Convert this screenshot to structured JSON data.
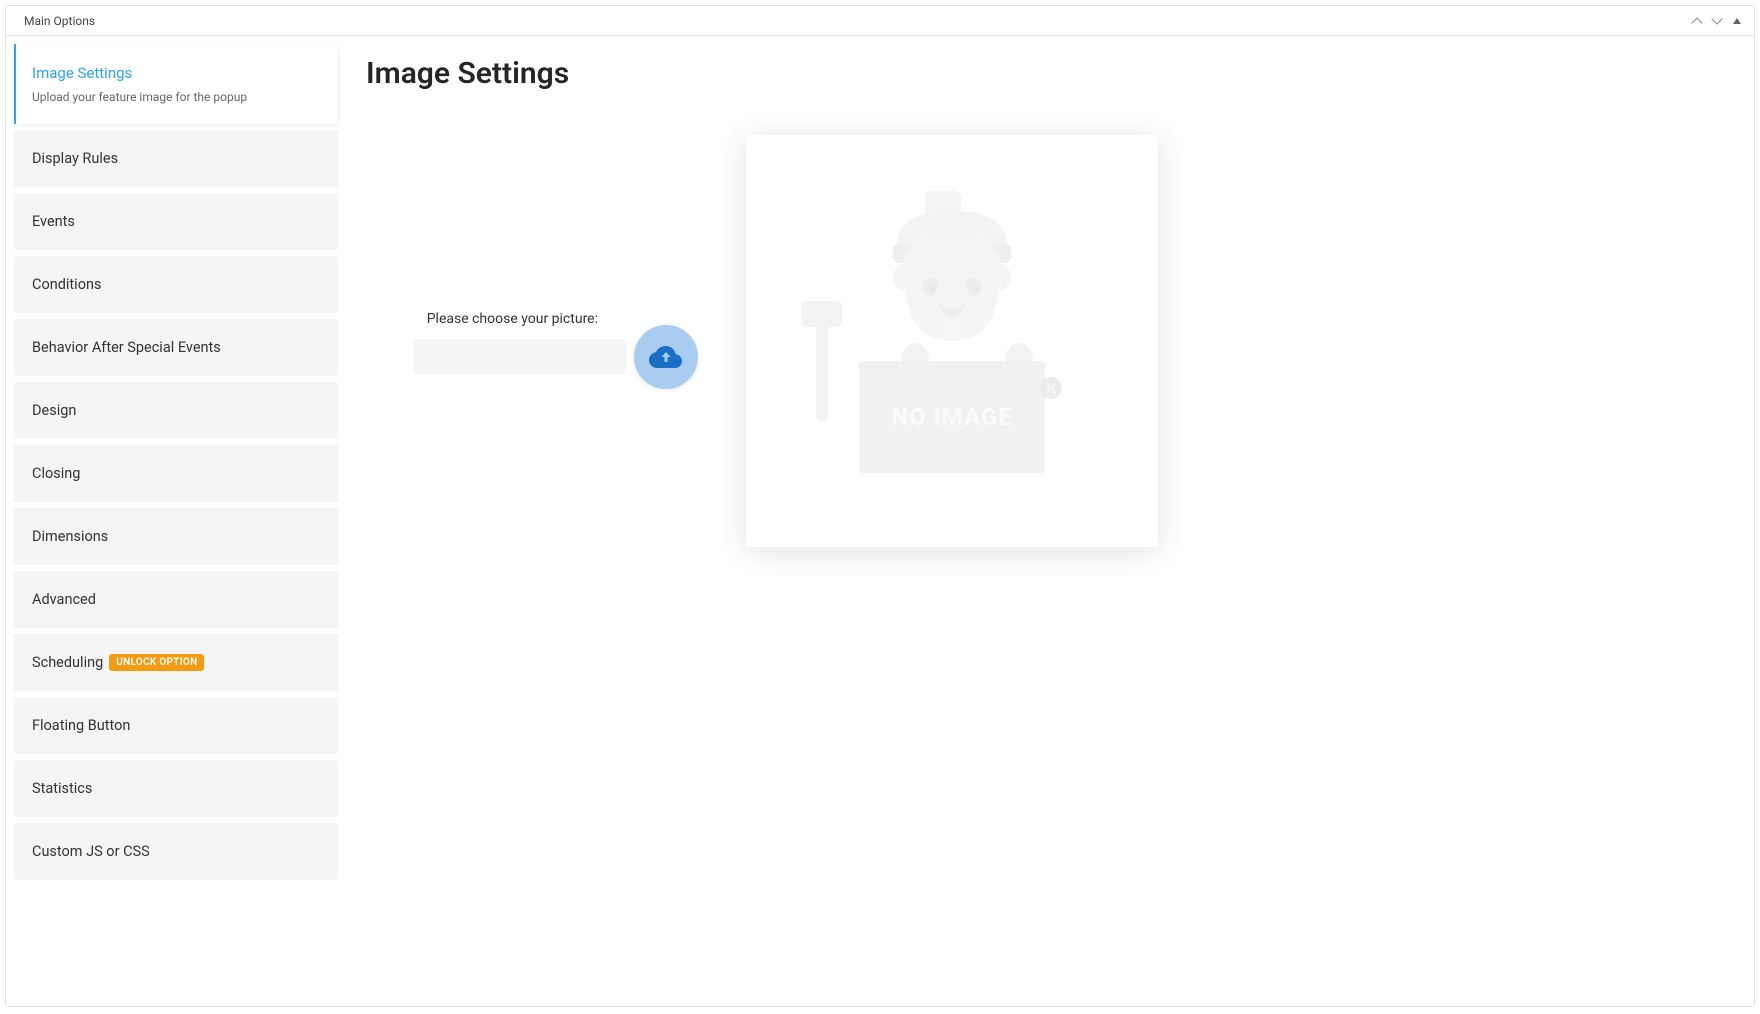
{
  "panel": {
    "title": "Main Options"
  },
  "sidebar": {
    "items": [
      {
        "label": "Image Settings",
        "subtitle": "Upload your feature image for the popup",
        "active": true
      },
      {
        "label": "Display Rules"
      },
      {
        "label": "Events"
      },
      {
        "label": "Conditions"
      },
      {
        "label": "Behavior After Special Events"
      },
      {
        "label": "Design"
      },
      {
        "label": "Closing"
      },
      {
        "label": "Dimensions"
      },
      {
        "label": "Advanced"
      },
      {
        "label": "Scheduling",
        "badge": "UNLOCK OPTION"
      },
      {
        "label": "Floating Button"
      },
      {
        "label": "Statistics"
      },
      {
        "label": "Custom JS or CSS"
      }
    ]
  },
  "content": {
    "heading": "Image Settings",
    "upload_label": "Please choose your picture:",
    "upload_value": "",
    "preview_placeholder_text": "NO IMAGE"
  },
  "colors": {
    "accent": "#2ea3f2",
    "badge_bg": "#f39c12",
    "upload_btn_bg": "#a8cdf0",
    "upload_btn_icon": "#1a6fc4"
  },
  "icons": {
    "chevron_up": "chevron-up-icon",
    "chevron_down": "chevron-down-icon",
    "triangle": "triangle-up-icon",
    "cloud_upload": "cloud-upload-icon",
    "close_circle": "close-circle-icon"
  }
}
